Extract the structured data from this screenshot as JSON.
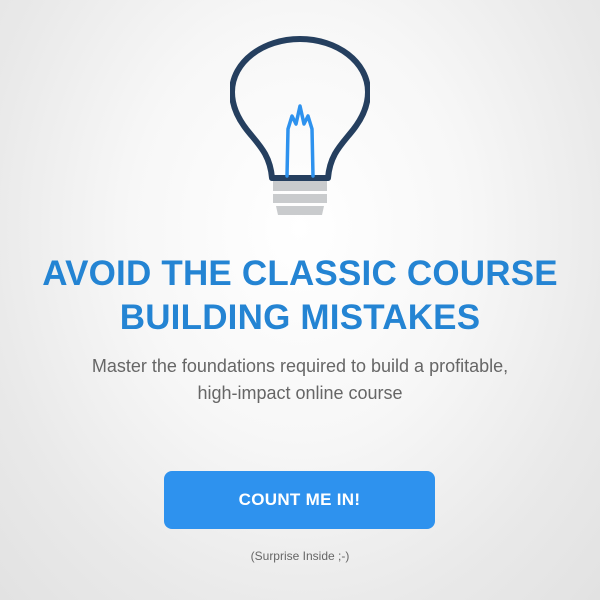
{
  "illustration": {
    "icon": "lightbulb-icon",
    "outline_color": "#253f5f",
    "filament_color": "#2e92ee",
    "base_color": "#c9cbcd"
  },
  "headline": {
    "line1": "AVOID THE CLASSIC COURSE",
    "line2": "BUILDING MISTAKES",
    "color": "#2484d3"
  },
  "subtitle": {
    "line1": "Master the foundations required to build a profitable,",
    "line2": "high-impact online course"
  },
  "cta": {
    "label": "COUNT ME IN!",
    "color": "#2e92ee"
  },
  "note": {
    "text": "(Surprise Inside ;-)"
  }
}
